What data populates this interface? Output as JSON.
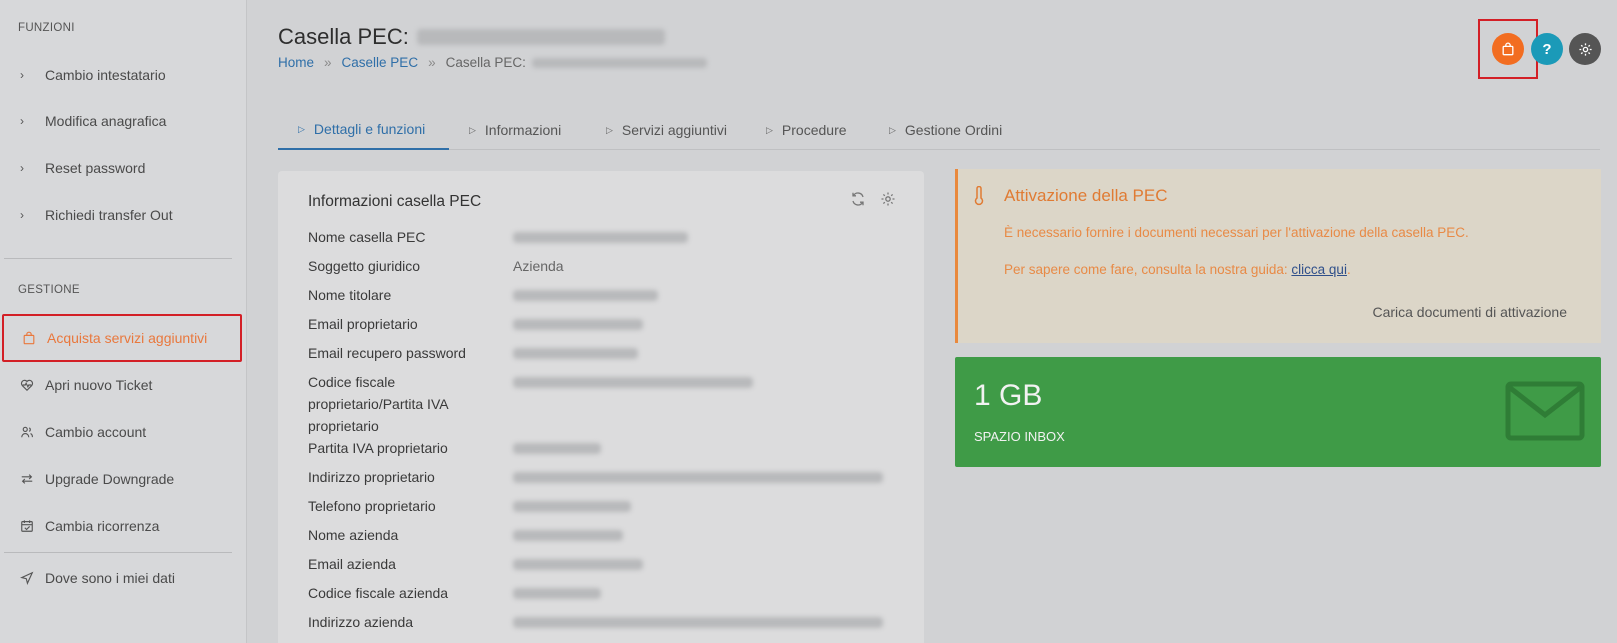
{
  "sidebar": {
    "section_functions": "FUNZIONI",
    "functions": [
      {
        "label": "Cambio intestatario",
        "icon": "chevron-right-icon"
      },
      {
        "label": "Modifica anagrafica",
        "icon": "chevron-right-icon"
      },
      {
        "label": "Reset password",
        "icon": "chevron-right-icon"
      },
      {
        "label": "Richiedi transfer Out",
        "icon": "chevron-right-icon"
      }
    ],
    "section_management": "GESTIONE",
    "management": [
      {
        "label": "Acquista servizi aggiuntivi",
        "icon": "shopping-bag-icon"
      },
      {
        "label": "Apri nuovo Ticket",
        "icon": "heartbeat-icon"
      },
      {
        "label": "Cambio account",
        "icon": "users-icon"
      },
      {
        "label": "Upgrade Downgrade",
        "icon": "arrows-exchange-icon"
      },
      {
        "label": "Cambia ricorrenza",
        "icon": "calendar-check-icon"
      }
    ],
    "data_location": {
      "label": "Dove sono i miei dati",
      "icon": "location-arrow-icon"
    }
  },
  "header": {
    "title": "Casella PEC:",
    "breadcrumb": [
      "Home",
      "Caselle PEC",
      "Casella PEC:"
    ],
    "breadcrumb_separator": "»"
  },
  "top_actions": {
    "cart": {
      "icon": "shopping-bag-icon",
      "color": "#f26d21"
    },
    "help": {
      "icon": "question-icon",
      "label": "?",
      "color": "#1b9ab8"
    },
    "settings": {
      "icon": "gear-icon",
      "color": "#555555"
    }
  },
  "tabs": [
    "Dettagli e funzioni",
    "Informazioni",
    "Servizi aggiuntivi",
    "Procedure",
    "Gestione Ordini"
  ],
  "active_tab": "Dettagli e funzioni",
  "info_card": {
    "title": "Informazioni casella PEC",
    "rows": [
      {
        "label": "Nome casella PEC",
        "value": ""
      },
      {
        "label": "Soggetto giuridico",
        "value": "Azienda"
      },
      {
        "label": "Nome titolare",
        "value": ""
      },
      {
        "label": "Email proprietario",
        "value": ""
      },
      {
        "label": "Email recupero password",
        "value": ""
      },
      {
        "label": "Codice fiscale proprietario/Partita IVA proprietario",
        "value": ""
      },
      {
        "label": "Partita IVA proprietario",
        "value": ""
      },
      {
        "label": "Indirizzo proprietario",
        "value": ""
      },
      {
        "label": "Telefono proprietario",
        "value": ""
      },
      {
        "label": "Nome azienda",
        "value": ""
      },
      {
        "label": "Email azienda",
        "value": ""
      },
      {
        "label": "Codice fiscale azienda",
        "value": ""
      },
      {
        "label": "Indirizzo azienda",
        "value": ""
      }
    ]
  },
  "alert": {
    "title": "Attivazione della PEC",
    "text1": "È necessario fornire i documenti necessari per l'attivazione della casella PEC.",
    "text2_prefix": "Per sapere come fare, consulta la nostra guida: ",
    "text2_link": "clicca qui",
    "text2_suffix": ".",
    "action": "Carica documenti di attivazione",
    "color": "#e07b33"
  },
  "storage": {
    "value": "1 GB",
    "label": "SPAZIO INBOX",
    "icon": "envelope-icon",
    "color": "#3f9b47"
  }
}
